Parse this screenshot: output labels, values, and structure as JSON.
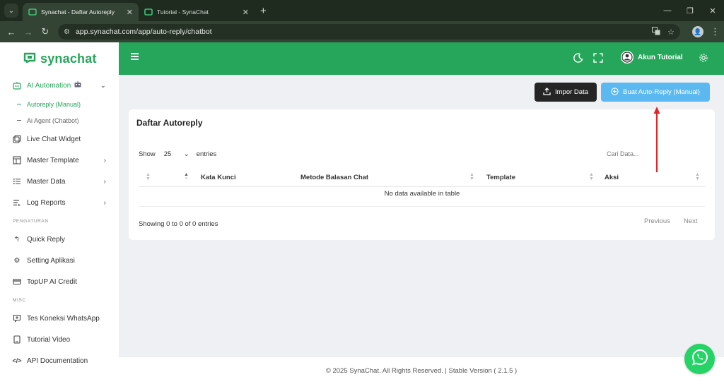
{
  "browser": {
    "tabs": [
      {
        "title": "Synachat - Daftar Autoreply",
        "active": true
      },
      {
        "title": "Tutorial - SynaChat",
        "active": false
      }
    ],
    "url": "app.synachat.com/app/auto-reply/chatbot"
  },
  "brand": {
    "name": "synachat",
    "color": "#26a65b"
  },
  "sidebar": {
    "ai_automation": {
      "label": "AI Automation",
      "children": [
        {
          "label": "Autoreply (Manual)",
          "active": true
        },
        {
          "label": "Ai Agent (Chatbot)",
          "active": false
        }
      ]
    },
    "items": [
      {
        "label": "Live Chat Widget",
        "icon": "widget-icon"
      },
      {
        "label": "Master Template",
        "icon": "template-icon"
      },
      {
        "label": "Master Data",
        "icon": "list-icon"
      },
      {
        "label": "Log Reports",
        "icon": "log-icon"
      }
    ],
    "section_pengaturan": "PENGATURAN",
    "settings_items": [
      {
        "label": "Quick Reply",
        "icon": "reply-icon"
      },
      {
        "label": "Setting Aplikasi",
        "icon": "gear-icon"
      },
      {
        "label": "TopUP AI Credit",
        "icon": "card-icon"
      }
    ],
    "section_misc": "MISC",
    "misc_items": [
      {
        "label": "Tes Koneksi WhatsApp",
        "icon": "chat-icon"
      },
      {
        "label": "Tutorial Video",
        "icon": "book-icon"
      },
      {
        "label": "API Documentation",
        "icon": "code-icon"
      }
    ]
  },
  "topbar": {
    "user_name": "Akun Tutorial"
  },
  "actions": {
    "import_label": "Impor Data",
    "create_label": "Buat Auto-Reply (Manual)"
  },
  "table": {
    "title": "Daftar Autoreply",
    "show_label": "Show",
    "page_size": "25",
    "entries_label": "entries",
    "search_placeholder": "Cari Data...",
    "columns": [
      "Kata Kunci",
      "Metode Balasan Chat",
      "Template",
      "Aksi"
    ],
    "empty_text": "No data available in table",
    "info": "Showing 0 to 0 of 0 entries",
    "prev_label": "Previous",
    "next_label": "Next"
  },
  "footer": {
    "text": "© 2025 SynaChat. All Rights Reserved. | Stable Version ( 2.1.5 )"
  },
  "colors": {
    "primary": "#25a65a",
    "info": "#5cb8f0",
    "dark": "#252525",
    "whatsapp": "#25d366",
    "annotation": "#e0262b"
  }
}
